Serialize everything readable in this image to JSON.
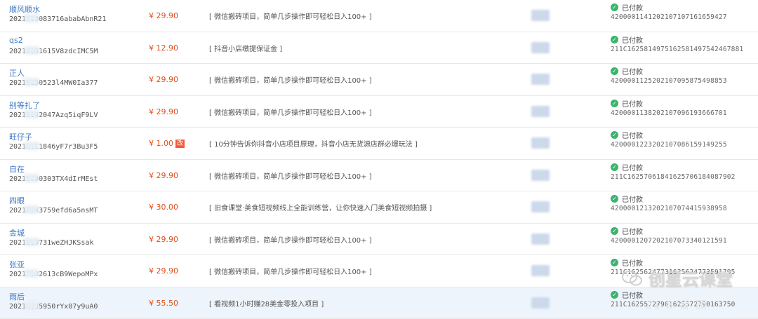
{
  "orders": [
    {
      "buyer": "顺风顺水",
      "order_no": "2021710083716ababAbnR21",
      "price": "¥ 29.90",
      "tag": "",
      "product": "[ 微信搬砖项目，简单几步操作即可轻松日入100+ ]",
      "status": "已付款",
      "txid": "4200001141202107107161659427"
    },
    {
      "buyer": "qs2",
      "order_no": "20219151615V8zdcIMC5M",
      "price": "¥ 12.90",
      "tag": "",
      "product": "[ 抖音小店缴提保证金 ]",
      "status": "已付款",
      "txid": "211C1625814975162581497542467881"
    },
    {
      "buyer": "正人",
      "order_no": "20219150523l4MW0Ia377",
      "price": "¥ 29.90",
      "tag": "",
      "product": "[ 微信搬砖项目，简单几步操作即可轻松日入100+ ]",
      "status": "已付款",
      "txid": "4200001125202107095875498853"
    },
    {
      "buyer": "别等扎了",
      "order_no": "20219142047Azq5iqF9LV",
      "price": "¥ 29.90",
      "tag": "",
      "product": "[ 微信搬砖项目，简单几步操作即可轻松日入100+ ]",
      "status": "已付款",
      "txid": "4200001138202107096193666701"
    },
    {
      "buyer": "旺仔子",
      "order_no": "20218111846yF7r3Bu3F5",
      "price": "¥ 1.00",
      "tag": "改",
      "product": "[ 10分钟告诉你抖音小店项目原理，抖音小店无货源店群必爆玩法 ]",
      "status": "已付款",
      "txid": "4200001223202107086159149255"
    },
    {
      "buyer": "自在",
      "order_no": "20218090303TX4dIrMEst",
      "price": "¥ 29.90",
      "tag": "",
      "product": "[ 微信搬砖项目，简单几步操作即可轻松日入100+ ]",
      "status": "已付款",
      "txid": "211C16257061841625706184087902"
    },
    {
      "buyer": "四眼",
      "order_no": "20217143759efd6a5nsMT",
      "price": "¥ 30.00",
      "tag": "",
      "product": "[ 旧食课堂·美食短视频线上全能训练营，让你快速入门美食短视频拍摄 ]",
      "status": "已付款",
      "txid": "4200001213202107074415938958"
    },
    {
      "buyer": "金城",
      "order_no": "2021110731weZHJKSsak",
      "price": "¥ 29.90",
      "tag": "",
      "product": "[ 微信搬砖项目，简单几步操作即可轻松日入100+ ]",
      "status": "已付款",
      "txid": "4200001207202107073340121591"
    },
    {
      "buyer": "张亚",
      "order_no": "20217102613cB9WepoMPx",
      "price": "¥ 29.90",
      "tag": "",
      "product": "[ 微信搬砖项目，简单几步操作即可轻松日入100+ ]",
      "status": "已付款",
      "txid": "211C16256247731625624773591795"
    },
    {
      "buyer": "雨后",
      "order_no": "20216195950rYx07y9uA0",
      "price": "¥ 55.50",
      "tag": "",
      "product": "[ 看视频1小时赚28美金零投入项目 ]",
      "status": "已付款",
      "txid": "211C16255727901625572790163750"
    }
  ],
  "watermark": {
    "brand": "创星云课堂",
    "sub": "21 8 音 图 ·"
  }
}
